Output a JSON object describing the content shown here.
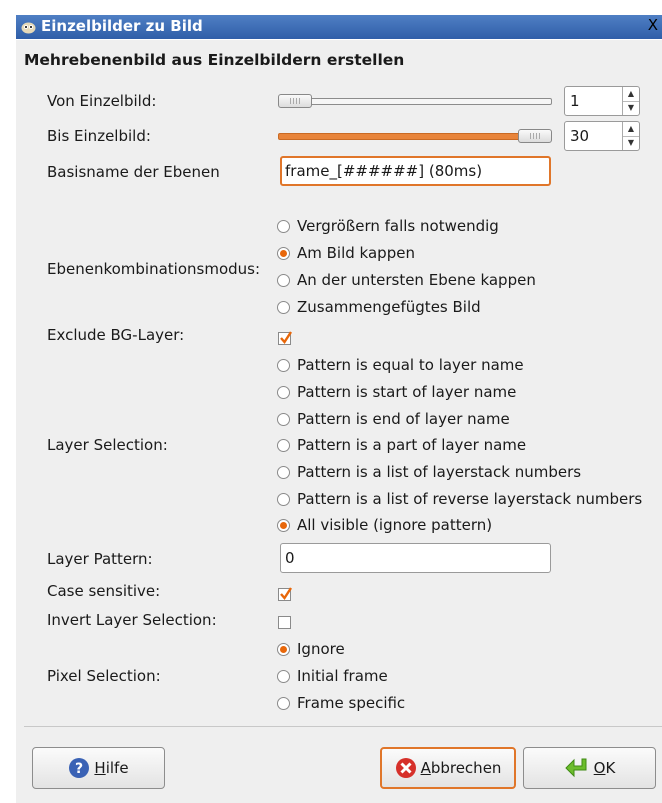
{
  "window": {
    "title": "Einzelbilder zu Bild",
    "close_glyph": "X"
  },
  "header": "Mehrebenenbild aus Einzelbildern erstellen",
  "from_frame": {
    "label": "Von Einzelbild:",
    "value": "1",
    "slider_fraction": 0.0
  },
  "to_frame": {
    "label": "Bis Einzelbild:",
    "value": "30",
    "slider_fraction": 1.0
  },
  "basename": {
    "label": "Basisname der Ebenen",
    "value": "frame_[######] (80ms)"
  },
  "combine_mode": {
    "label": "Ebenenkombinationsmodus:",
    "options": [
      "Vergrößern falls notwendig",
      "Am Bild kappen",
      "An der untersten Ebene kappen",
      "Zusammengefügtes Bild"
    ],
    "selected": 1
  },
  "exclude_bg": {
    "label": "Exclude BG-Layer:",
    "checked": true
  },
  "layer_selection": {
    "label": "Layer Selection:",
    "options": [
      "Pattern is equal to layer name",
      "Pattern is start of layer name",
      "Pattern is end of layer name",
      "Pattern is a part of layer name",
      "Pattern is a list of layerstack numbers",
      "Pattern is a list of reverse layerstack numbers",
      "All visible (ignore pattern)"
    ],
    "selected": 6
  },
  "layer_pattern": {
    "label": "Layer Pattern:",
    "value": "0"
  },
  "case_sensitive": {
    "label": "Case sensitive:",
    "checked": true
  },
  "invert_selection": {
    "label": "Invert Layer Selection:",
    "checked": false
  },
  "pixel_selection": {
    "label": "Pixel Selection:",
    "options": [
      "Ignore",
      "Initial frame",
      "Frame specific"
    ],
    "selected": 0
  },
  "buttons": {
    "help": {
      "mnemonic": "H",
      "rest": "ilfe"
    },
    "cancel": {
      "mnemonic": "A",
      "rest": "bbrechen"
    },
    "ok": {
      "mnemonic": "O",
      "rest": "K"
    }
  },
  "colors": {
    "accent": "#e8670a",
    "titlebar": "#2f5ea8",
    "dialog_bg": "#efefef"
  }
}
